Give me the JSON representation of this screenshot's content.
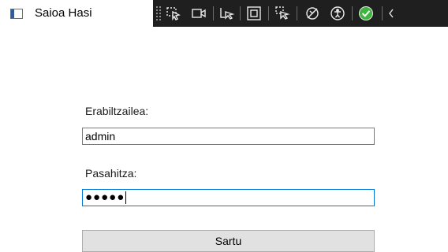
{
  "window": {
    "title": "Saioa Hasi",
    "icon": "window-app-icon"
  },
  "debug_toolbar": {
    "buttons": [
      {
        "name": "select-element-icon"
      },
      {
        "name": "video-camera-icon"
      },
      {
        "name": "cursor-select-icon"
      },
      {
        "name": "display-layout-adorners-icon"
      },
      {
        "name": "track-focused-element-icon"
      },
      {
        "name": "binding-failures-icon"
      },
      {
        "name": "accessibility-icon"
      },
      {
        "name": "check-circle-icon"
      },
      {
        "name": "collapse-chevron-icon"
      }
    ],
    "accent_color": "#3fb43f"
  },
  "form": {
    "username_label": "Erabiltzailea:",
    "username_value": "admin",
    "password_label": "Pasahitza:",
    "password_masked": "●●●●●",
    "submit_label": "Sartu"
  },
  "colors": {
    "focus_border": "#0078d7",
    "button_bg": "#e1e1e1"
  }
}
